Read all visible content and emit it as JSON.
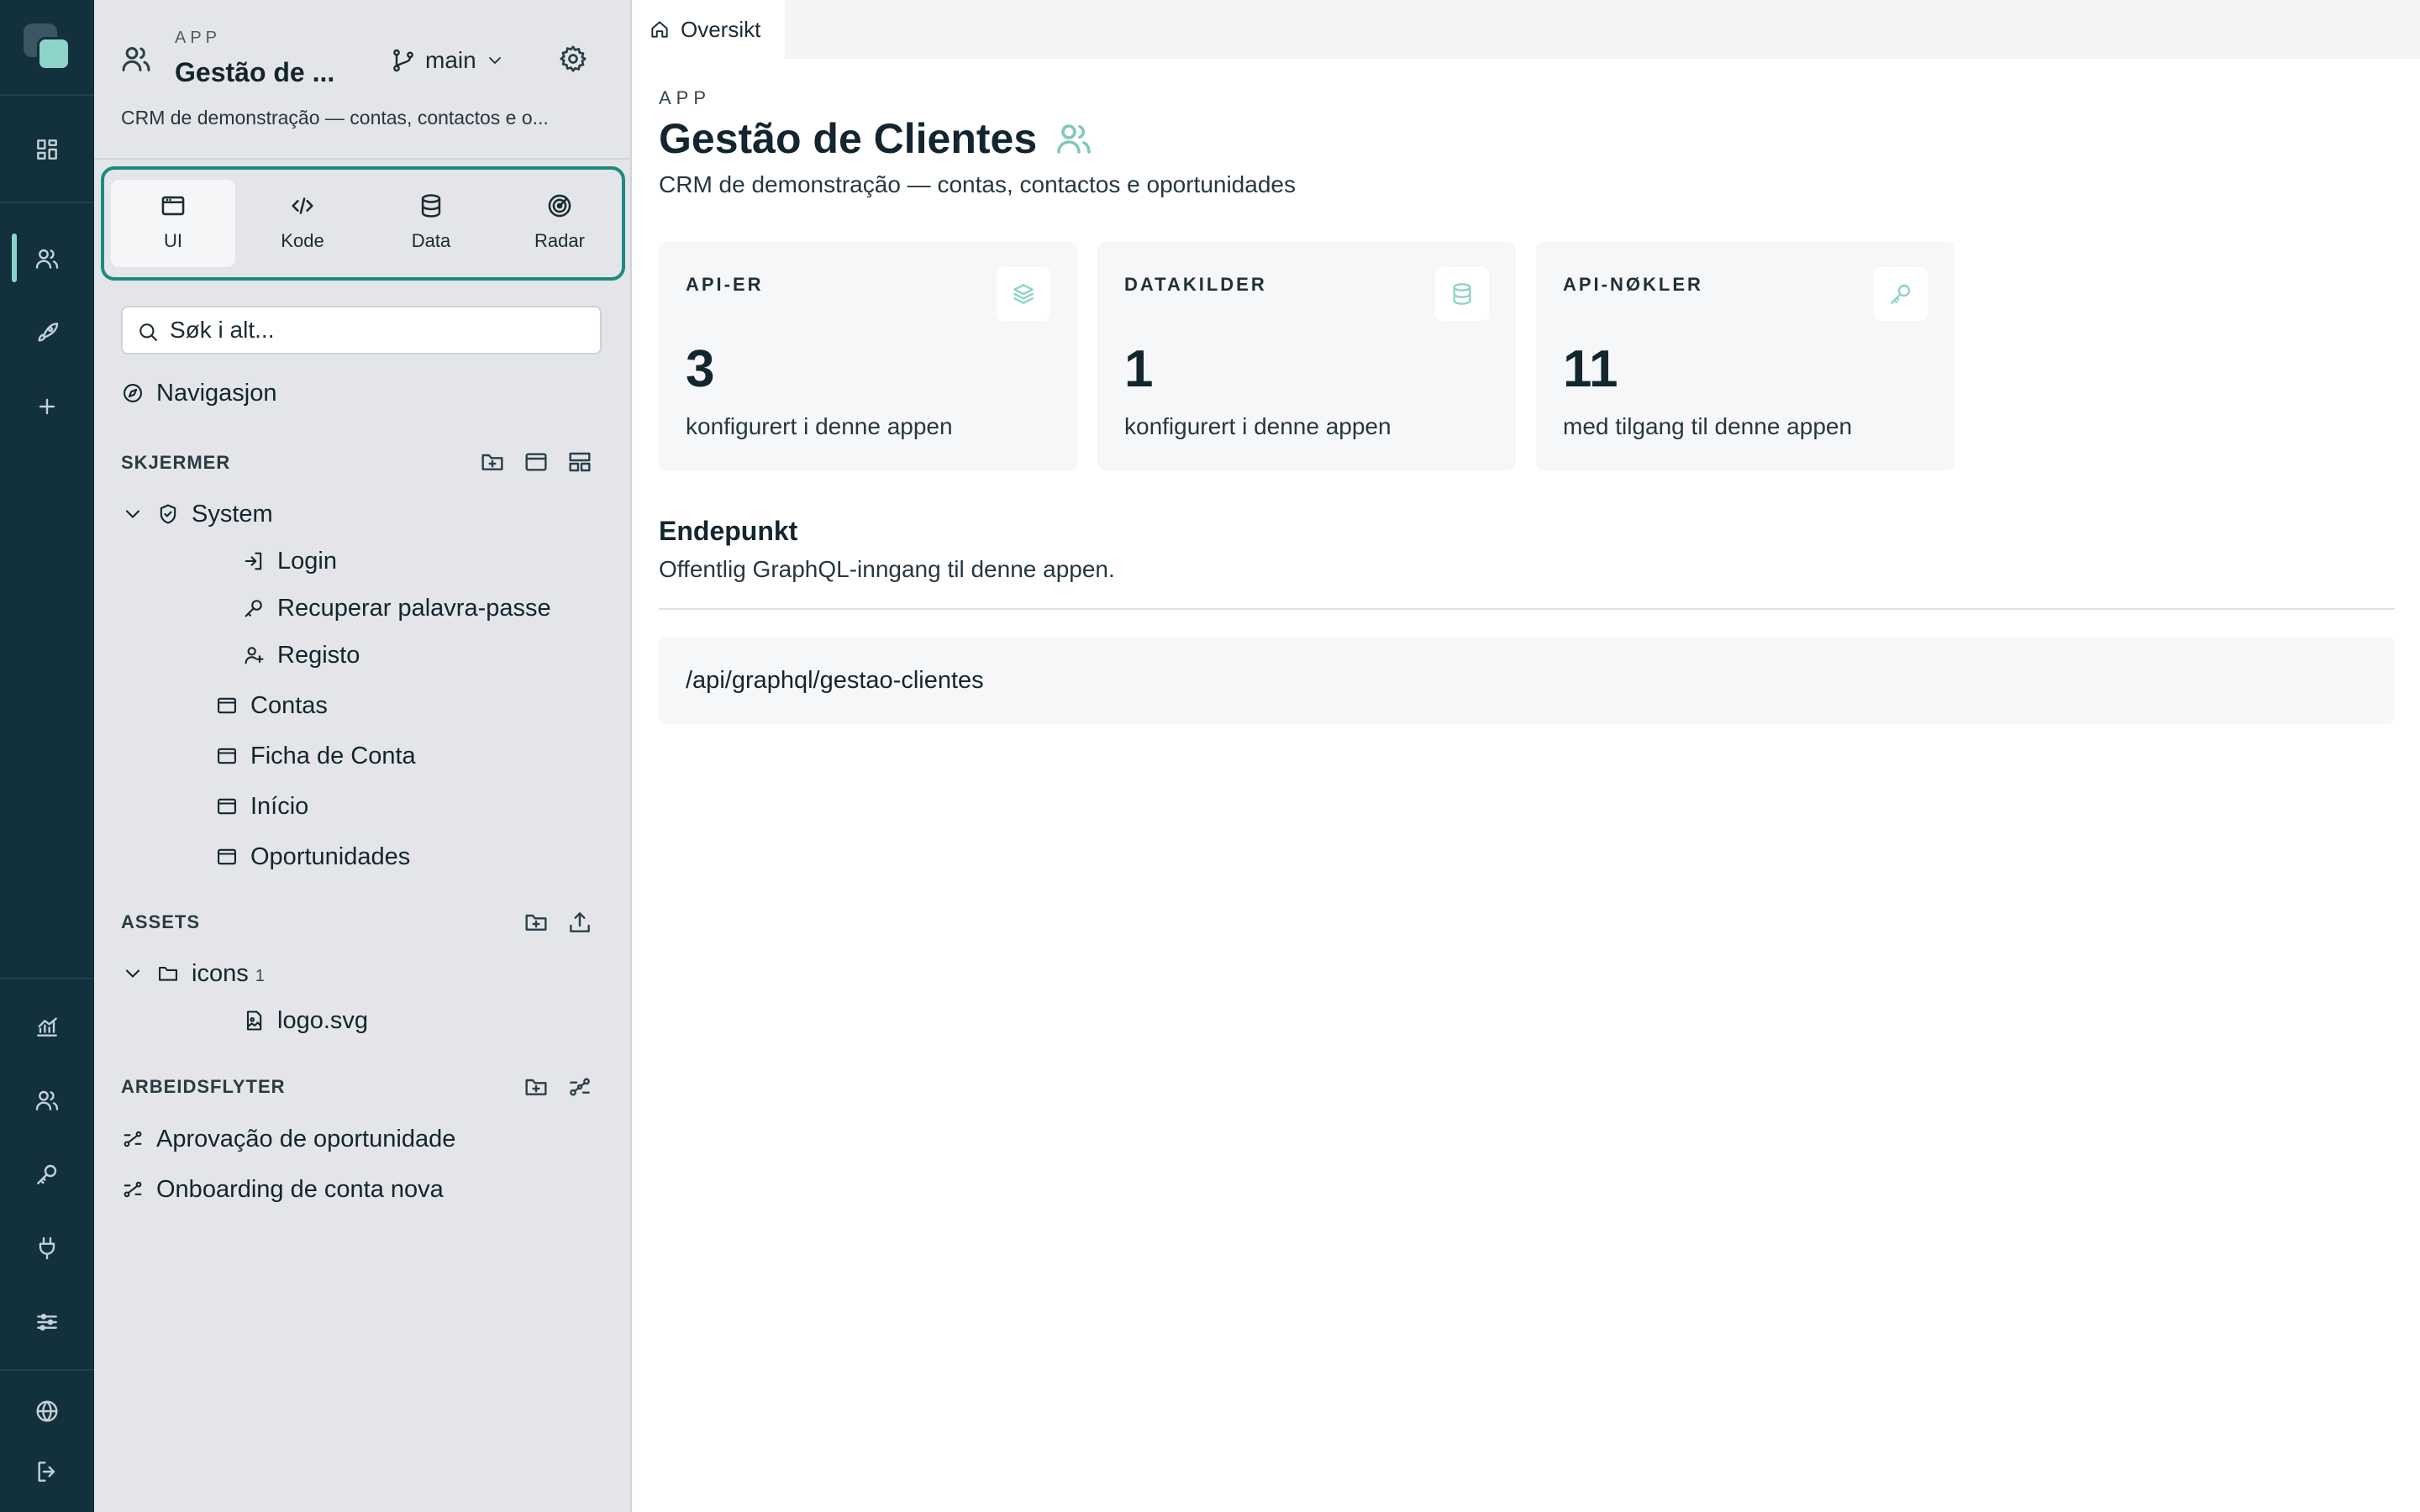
{
  "rail": {
    "icons": [
      "logo",
      "grid-icon",
      "users-icon",
      "rocket-icon",
      "plus-icon",
      "chart-icon",
      "users-icon",
      "key-icon",
      "plug-icon",
      "sliders-icon",
      "globe-icon",
      "logout-icon"
    ],
    "active": "users-icon"
  },
  "app": {
    "kicker": "APP",
    "name": "Gestão de ...",
    "branch": "main",
    "description": "CRM de demonstração — contas, contactos e o..."
  },
  "modes": [
    {
      "label": "UI",
      "icon": "window-icon",
      "active": true
    },
    {
      "label": "Kode",
      "icon": "code-icon",
      "active": false
    },
    {
      "label": "Data",
      "icon": "database-icon",
      "active": false
    },
    {
      "label": "Radar",
      "icon": "radar-icon",
      "active": false
    }
  ],
  "search": {
    "placeholder": "Søk i alt..."
  },
  "navigation_label": "Navigasjon",
  "screens": {
    "title": "SKJERMER",
    "group": "System",
    "system_items": [
      "Login",
      "Recuperar palavra-passe",
      "Registo"
    ],
    "items": [
      "Contas",
      "Ficha de Conta",
      "Início",
      "Oportunidades"
    ]
  },
  "assets": {
    "title": "ASSETS",
    "folder": "icons",
    "folder_count": "1",
    "files": [
      "logo.svg"
    ]
  },
  "workflows": {
    "title": "ARBEIDSFLYTER",
    "items": [
      "Aprovação de oportunidade",
      "Onboarding de conta nova"
    ]
  },
  "tab": {
    "label": "Oversikt"
  },
  "main": {
    "kicker": "APP",
    "title": "Gestão de Clientes",
    "subtitle": "CRM de demonstração — contas, contactos e oportunidades",
    "cards": [
      {
        "label": "API-ER",
        "value": "3",
        "caption": "konfigurert i denne appen",
        "icon": "layers-icon"
      },
      {
        "label": "DATAKILDER",
        "value": "1",
        "caption": "konfigurert i denne appen",
        "icon": "database-icon"
      },
      {
        "label": "API-NØKLER",
        "value": "11",
        "caption": "med tilgang til denne appen",
        "icon": "key-icon"
      }
    ],
    "endpoint": {
      "title": "Endepunkt",
      "description": "Offentlig GraphQL-inngang til denne appen.",
      "path": "/api/graphql/gestao-clientes"
    }
  },
  "colors": {
    "rail_bg": "#13303d",
    "accent": "#1e8a7d",
    "accent_light": "#8fd3c8",
    "sidebar_bg": "#e3e5e8"
  }
}
